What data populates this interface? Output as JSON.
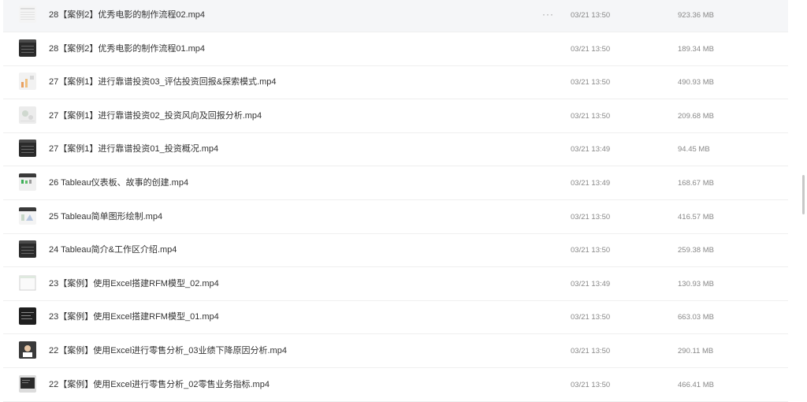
{
  "more_label": "···",
  "files": [
    {
      "name": "28【案例2】优秀电影的制作流程02.mp4",
      "date": "03/21 13:50",
      "size": "923.36 MB",
      "thumb_icon": "video-thumbnail-icon",
      "hover": true
    },
    {
      "name": "28【案例2】优秀电影的制作流程01.mp4",
      "date": "03/21 13:50",
      "size": "189.34 MB",
      "thumb_icon": "video-thumbnail-icon",
      "hover": false
    },
    {
      "name": "27【案例1】进行靠谱投资03_评估投资回报&探索模式.mp4",
      "date": "03/21 13:50",
      "size": "490.93 MB",
      "thumb_icon": "video-thumbnail-icon",
      "hover": false
    },
    {
      "name": "27【案例1】进行靠谱投资02_投资风向及回报分析.mp4",
      "date": "03/21 13:50",
      "size": "209.68 MB",
      "thumb_icon": "video-thumbnail-icon",
      "hover": false
    },
    {
      "name": "27【案例1】进行靠谱投资01_投资概况.mp4",
      "date": "03/21 13:49",
      "size": "94.45 MB",
      "thumb_icon": "video-thumbnail-icon",
      "hover": false
    },
    {
      "name": "26 Tableau仪表板、故事的创建.mp4",
      "date": "03/21 13:49",
      "size": "168.67 MB",
      "thumb_icon": "video-thumbnail-icon",
      "hover": false
    },
    {
      "name": "25 Tableau简单图形绘制.mp4",
      "date": "03/21 13:50",
      "size": "416.57 MB",
      "thumb_icon": "video-thumbnail-icon",
      "hover": false
    },
    {
      "name": "24 Tableau简介&工作区介绍.mp4",
      "date": "03/21 13:50",
      "size": "259.38 MB",
      "thumb_icon": "video-thumbnail-icon",
      "hover": false
    },
    {
      "name": "23【案例】使用Excel搭建RFM模型_02.mp4",
      "date": "03/21 13:49",
      "size": "130.93 MB",
      "thumb_icon": "video-thumbnail-icon",
      "hover": false
    },
    {
      "name": "23【案例】使用Excel搭建RFM模型_01.mp4",
      "date": "03/21 13:50",
      "size": "663.03 MB",
      "thumb_icon": "video-thumbnail-icon",
      "hover": false
    },
    {
      "name": "22【案例】使用Excel进行零售分析_03业绩下降原因分析.mp4",
      "date": "03/21 13:50",
      "size": "290.11 MB",
      "thumb_icon": "video-thumbnail-icon",
      "hover": false
    },
    {
      "name": "22【案例】使用Excel进行零售分析_02零售业务指标.mp4",
      "date": "03/21 13:50",
      "size": "466.41 MB",
      "thumb_icon": "video-thumbnail-icon",
      "hover": false
    }
  ]
}
